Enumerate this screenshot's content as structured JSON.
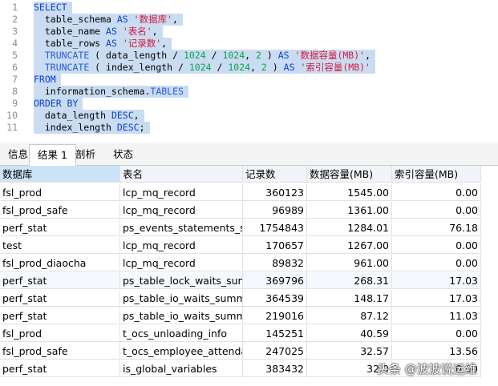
{
  "editor": {
    "lines": [
      {
        "n": "1",
        "parts": [
          [
            "kw",
            "SELECT"
          ]
        ]
      },
      {
        "n": "2",
        "parts": [
          [
            "pl",
            "  table_schema "
          ],
          [
            "kw",
            "AS"
          ],
          [
            "pl",
            " "
          ],
          [
            "str",
            "'数据库'"
          ],
          [
            "pl",
            ","
          ]
        ]
      },
      {
        "n": "3",
        "parts": [
          [
            "pl",
            "  table_name "
          ],
          [
            "kw",
            "AS"
          ],
          [
            "pl",
            " "
          ],
          [
            "str",
            "'表名'"
          ],
          [
            "pl",
            ","
          ]
        ]
      },
      {
        "n": "4",
        "parts": [
          [
            "pl",
            "  table_rows "
          ],
          [
            "kw",
            "AS"
          ],
          [
            "pl",
            " "
          ],
          [
            "str",
            "'记录数'"
          ],
          [
            "pl",
            ","
          ]
        ]
      },
      {
        "n": "5",
        "parts": [
          [
            "pl",
            "  "
          ],
          [
            "fn",
            "TRUNCATE"
          ],
          [
            "pl",
            " ( data_length / "
          ],
          [
            "num",
            "1024"
          ],
          [
            "pl",
            " / "
          ],
          [
            "num",
            "1024"
          ],
          [
            "pl",
            ", "
          ],
          [
            "num",
            "2"
          ],
          [
            "pl",
            " ) "
          ],
          [
            "kw",
            "AS"
          ],
          [
            "pl",
            " "
          ],
          [
            "str",
            "'数据容量(MB)'"
          ],
          [
            "pl",
            ","
          ]
        ]
      },
      {
        "n": "6",
        "parts": [
          [
            "pl",
            "  "
          ],
          [
            "fn",
            "TRUNCATE"
          ],
          [
            "pl",
            " ( index_length / "
          ],
          [
            "num",
            "1024"
          ],
          [
            "pl",
            " / "
          ],
          [
            "num",
            "1024"
          ],
          [
            "pl",
            ", "
          ],
          [
            "num",
            "2"
          ],
          [
            "pl",
            " ) "
          ],
          [
            "kw",
            "AS"
          ],
          [
            "pl",
            " "
          ],
          [
            "str",
            "'索引容量(MB)'"
          ]
        ]
      },
      {
        "n": "7",
        "parts": [
          [
            "kw",
            "FROM"
          ]
        ]
      },
      {
        "n": "8",
        "parts": [
          [
            "pl",
            "  information_schema."
          ],
          [
            "fn",
            "TABLES"
          ]
        ]
      },
      {
        "n": "9",
        "parts": [
          [
            "kw",
            "ORDER BY"
          ]
        ]
      },
      {
        "n": "10",
        "parts": [
          [
            "pl",
            "  data_length "
          ],
          [
            "kw",
            "DESC"
          ],
          [
            "pl",
            ","
          ]
        ]
      },
      {
        "n": "11",
        "parts": [
          [
            "pl",
            "  index_length "
          ],
          [
            "kw",
            "DESC"
          ],
          [
            "pl",
            ";"
          ]
        ]
      }
    ]
  },
  "tabs": [
    {
      "label": "信息",
      "active": false
    },
    {
      "label": "结果 1",
      "active": true
    },
    {
      "label": "剖析",
      "active": false
    },
    {
      "label": "状态",
      "active": false
    }
  ],
  "grid": {
    "columns": [
      "数据库",
      "表名",
      "记录数",
      "数据容量(MB)",
      "索引容量(MB)"
    ],
    "rows": [
      [
        "fsl_prod",
        "lcp_mq_record",
        "360123",
        "1545.00",
        "0.00"
      ],
      [
        "fsl_prod_safe",
        "lcp_mq_record",
        "96989",
        "1361.00",
        "0.00"
      ],
      [
        "perf_stat",
        "ps_events_statements_summary",
        "1754843",
        "1284.01",
        "76.18"
      ],
      [
        "test",
        "lcp_mq_record",
        "170657",
        "1267.00",
        "0.00"
      ],
      [
        "fsl_prod_diaocha",
        "lcp_mq_record",
        "89832",
        "961.00",
        "0.00"
      ],
      [
        "perf_stat",
        "ps_table_lock_waits_summary",
        "369796",
        "268.31",
        "17.03"
      ],
      [
        "perf_stat",
        "ps_table_io_waits_summary",
        "364539",
        "148.17",
        "17.03"
      ],
      [
        "perf_stat",
        "ps_table_io_waits_summary",
        "219016",
        "87.12",
        "11.03"
      ],
      [
        "fsl_prod",
        "t_ocs_unloading_info",
        "145251",
        "40.59",
        "0.00"
      ],
      [
        "fsl_prod_safe",
        "t_ocs_employee_attendance",
        "247025",
        "32.57",
        "13.56"
      ],
      [
        "perf_stat",
        "is_global_variables",
        "383432",
        "32.0",
        "0.00"
      ]
    ]
  },
  "watermark": {
    "text": "头条 @波波说运维"
  }
}
